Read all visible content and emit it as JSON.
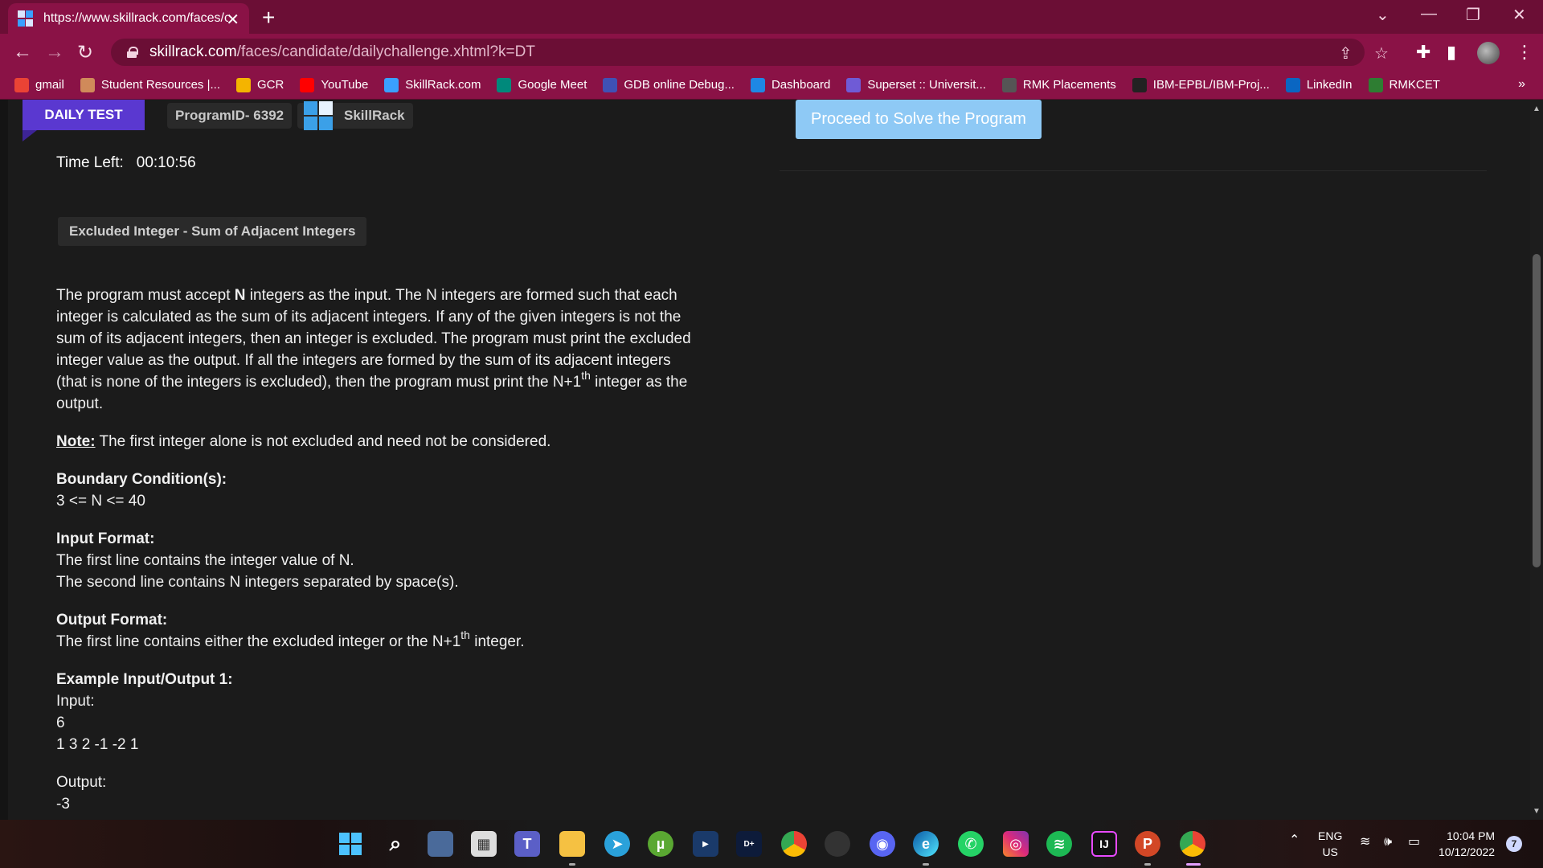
{
  "browser": {
    "tab_title": "https://www.skillrack.com/faces/c",
    "url_host": "skillrack.com",
    "url_path": "/faces/candidate/dailychallenge.xhtml?k=DT",
    "bookmarks": [
      {
        "label": "gmail",
        "icon": "gmail-icon",
        "color": "#ea4335"
      },
      {
        "label": "Student Resources |...",
        "icon": "student-resources-icon",
        "color": "#d08a5a"
      },
      {
        "label": "GCR",
        "icon": "google-classroom-icon",
        "color": "#f4b400"
      },
      {
        "label": "YouTube",
        "icon": "youtube-icon",
        "color": "#ff0000"
      },
      {
        "label": "SkillRack.com",
        "icon": "skillrack-icon",
        "color": "#3aa0ff"
      },
      {
        "label": "Google Meet",
        "icon": "google-meet-icon",
        "color": "#00897b"
      },
      {
        "label": "GDB online Debug...",
        "icon": "gdb-icon",
        "color": "#3f51b5"
      },
      {
        "label": "Dashboard",
        "icon": "dashboard-icon",
        "color": "#1e88e5"
      },
      {
        "label": "Superset :: Universit...",
        "icon": "superset-icon",
        "color": "#6f5bd6"
      },
      {
        "label": "RMK Placements",
        "icon": "rmk-placements-icon",
        "color": "#555555"
      },
      {
        "label": "IBM-EPBL/IBM-Proj...",
        "icon": "github-icon",
        "color": "#222222"
      },
      {
        "label": "LinkedIn",
        "icon": "linkedin-icon",
        "color": "#0a66c2"
      },
      {
        "label": "RMKCET",
        "icon": "rmkcet-icon",
        "color": "#2e7d32"
      }
    ],
    "bookmarks_more": "»"
  },
  "header": {
    "ribbon_label": "DAILY TEST",
    "program_id": "ProgramID- 6392",
    "brand": "SkillRack",
    "proceed_label": "Proceed to Solve the Program"
  },
  "timer": {
    "label": "Time Left:",
    "value": "00:10:56"
  },
  "problem": {
    "title": "Excluded Integer - Sum of Adjacent Integers",
    "desc_lines": {
      "l1_a": "The program must accept ",
      "l1_b": "N",
      "l1_c": " integers as the input. The N integers are formed such that each",
      "l2": "integer is calculated as the sum of its adjacent integers. If any of the given integers is not the",
      "l3": "sum of its adjacent integers, then an integer is excluded. The program must print the excluded",
      "l4": "integer value as the output. If all the integers are formed by the sum of its adjacent integers",
      "l5_a": "(that is none of the integers is excluded), then the program must print the N+1",
      "l5_sup": "th",
      "l5_b": " integer as the",
      "l6": "output."
    },
    "note_label": "Note:",
    "note_text": " The first integer alone is not excluded and need not be considered.",
    "boundary_heading": "Boundary Condition(s):",
    "boundary_text": "3 <= N <= 40",
    "input_heading": "Input Format:",
    "input_line1": "The first line contains the integer value of N.",
    "input_line2": "The second line contains N integers separated by space(s).",
    "output_heading": "Output Format:",
    "output_text_a": "The first line contains either the excluded integer or the N+1",
    "output_sup": "th",
    "output_text_b": " integer.",
    "example_heading": "Example Input/Output 1:",
    "example_input_label": "Input:",
    "example_input_n": "6",
    "example_input_values": "1 3 2 -1 -2 1",
    "example_output_label": "Output:",
    "example_output_value": "-3"
  },
  "taskbar": {
    "lang_top": "ENG",
    "lang_bottom": "US",
    "time": "10:04 PM",
    "date": "10/12/2022",
    "notifications": "7"
  }
}
